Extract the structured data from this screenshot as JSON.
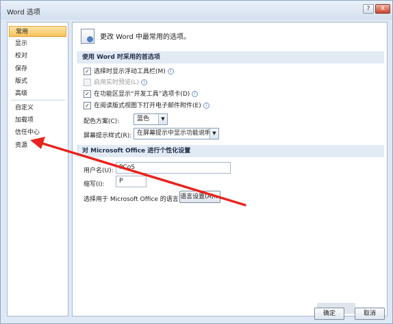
{
  "window": {
    "title": "Word 选项"
  },
  "titlebar_buttons": {
    "help": "?",
    "close": "X"
  },
  "nav": {
    "items": [
      "常用",
      "显示",
      "校对",
      "保存",
      "版式",
      "高级",
      "自定义",
      "加载项",
      "信任中心",
      "资源"
    ],
    "selected": "常用"
  },
  "header": {
    "text": "更改 Word 中最常用的选项。"
  },
  "section1": {
    "title": "使用 Word 时采用的首选项",
    "options": [
      {
        "label": "选择时显示浮动工具栏(M)",
        "checked": true,
        "enabled": true
      },
      {
        "label": "启用实时预览(L)",
        "checked": false,
        "enabled": false
      },
      {
        "label": "在功能区显示“开发工具”选项卡(D)",
        "checked": true,
        "enabled": true
      },
      {
        "label": "在阅读版式视图下打开电子邮件附件(E)",
        "checked": true,
        "enabled": true
      }
    ],
    "check_mark": "✓",
    "info_glyph": "i",
    "color_scheme_label": "配色方案(C):",
    "color_scheme_value": "蓝色",
    "tooltip_style_label": "屏幕提示样式(R):",
    "tooltip_style_value": "在屏幕提示中显示功能说明",
    "dropdown_glyph": "▼"
  },
  "section2": {
    "title": "对 Microsoft Office 进行个性化设置",
    "username_label": "用户名(U):",
    "username_value": "PCoS",
    "initials_label": "缩写(I):",
    "initials_value": "P",
    "language_label": "选择用于 Microsoft Office 的语言:",
    "language_button": "语言设置(A)..."
  },
  "footer": {
    "ok": "确定",
    "cancel": "取消"
  },
  "colors": {
    "annotation_arrow": "#e8231d",
    "selected_nav": "#f8c15a"
  }
}
